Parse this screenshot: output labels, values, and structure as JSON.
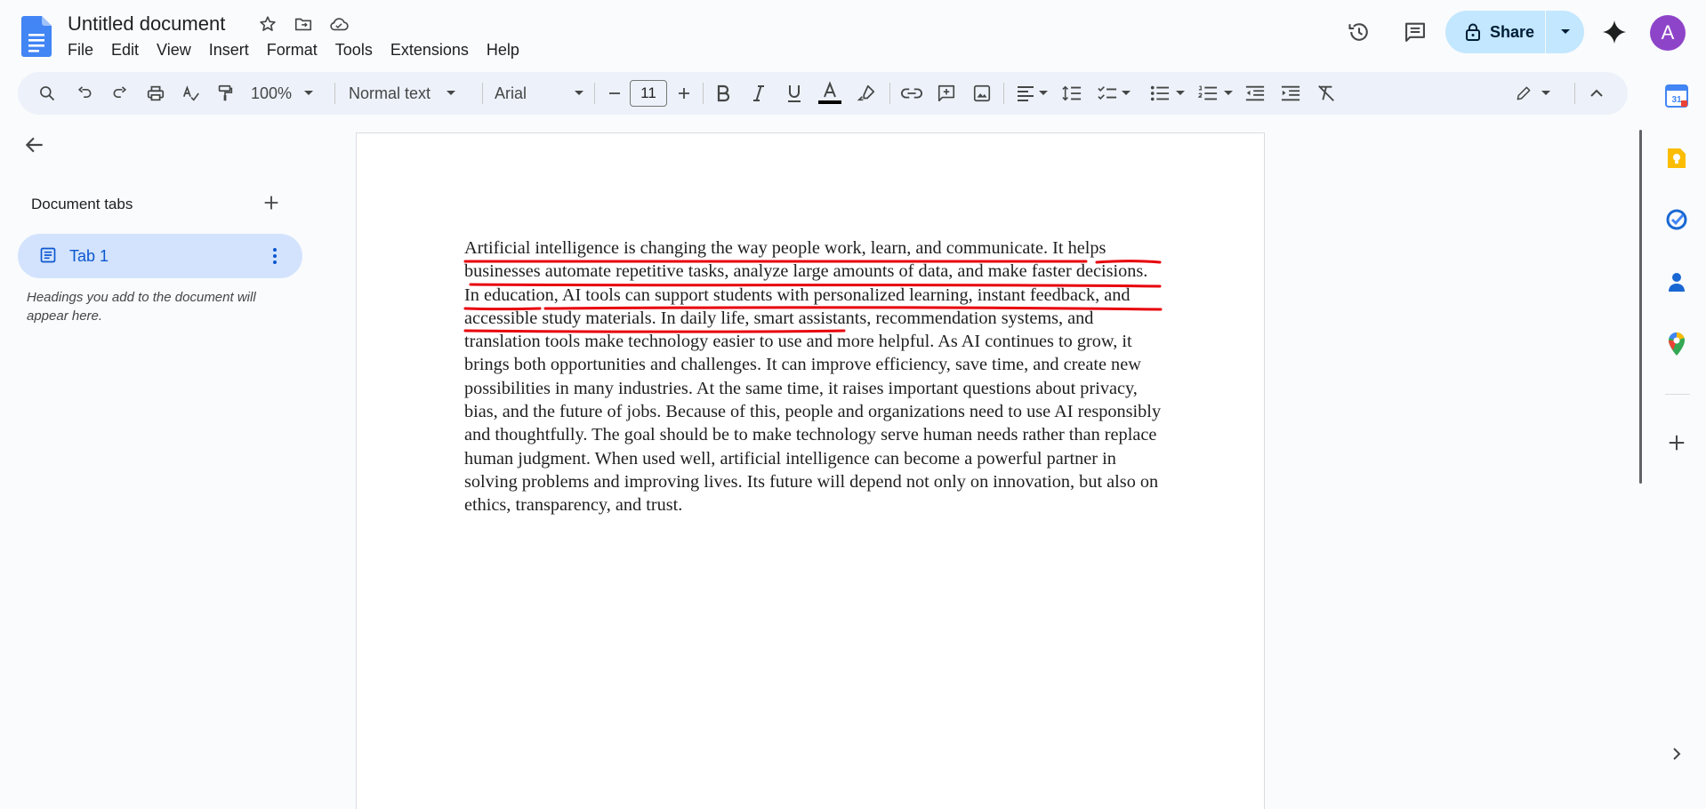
{
  "app": {
    "title": "Untitled document",
    "menu": [
      "File",
      "Edit",
      "View",
      "Insert",
      "Format",
      "Tools",
      "Extensions",
      "Help"
    ]
  },
  "header": {
    "share_label": "Share",
    "avatar_letter": "A",
    "avatar_color": "#8e44c8",
    "share_bg": "#c2e7ff"
  },
  "toolbar": {
    "zoom": "100%",
    "style": "Normal text",
    "font": "Arial",
    "font_size": "11",
    "text_color": "#000000"
  },
  "sidebar": {
    "title": "Document tabs",
    "tab_label": "Tab 1",
    "hint": "Headings you add to the document will appear here."
  },
  "document": {
    "text": "Artificial intelligence is changing the way people work, learn, and communicate. It helps businesses automate repetitive tasks, analyze large amounts of data, and make faster decisions. In education, AI tools can support students with personalized learning, instant feedback, and accessible study materials. In daily life, smart assistants, recommendation systems, and translation tools make technology easier to use and more helpful. As AI continues to grow, it brings both opportunities and challenges. It can improve efficiency, save time, and create new possibilities in many industries. At the same time, it raises important questions about privacy, bias, and the future of jobs. Because of this, people and organizations need to use AI responsibly and thoughtfully. The goal should be to make technology serve human needs rather than replace human judgment. When used well, artificial intelligence can become a powerful partner in solving problems and improving lives. Its future will depend not only on innovation, but also on ethics, transparency, and trust.",
    "underline_color": "#e8000b"
  }
}
